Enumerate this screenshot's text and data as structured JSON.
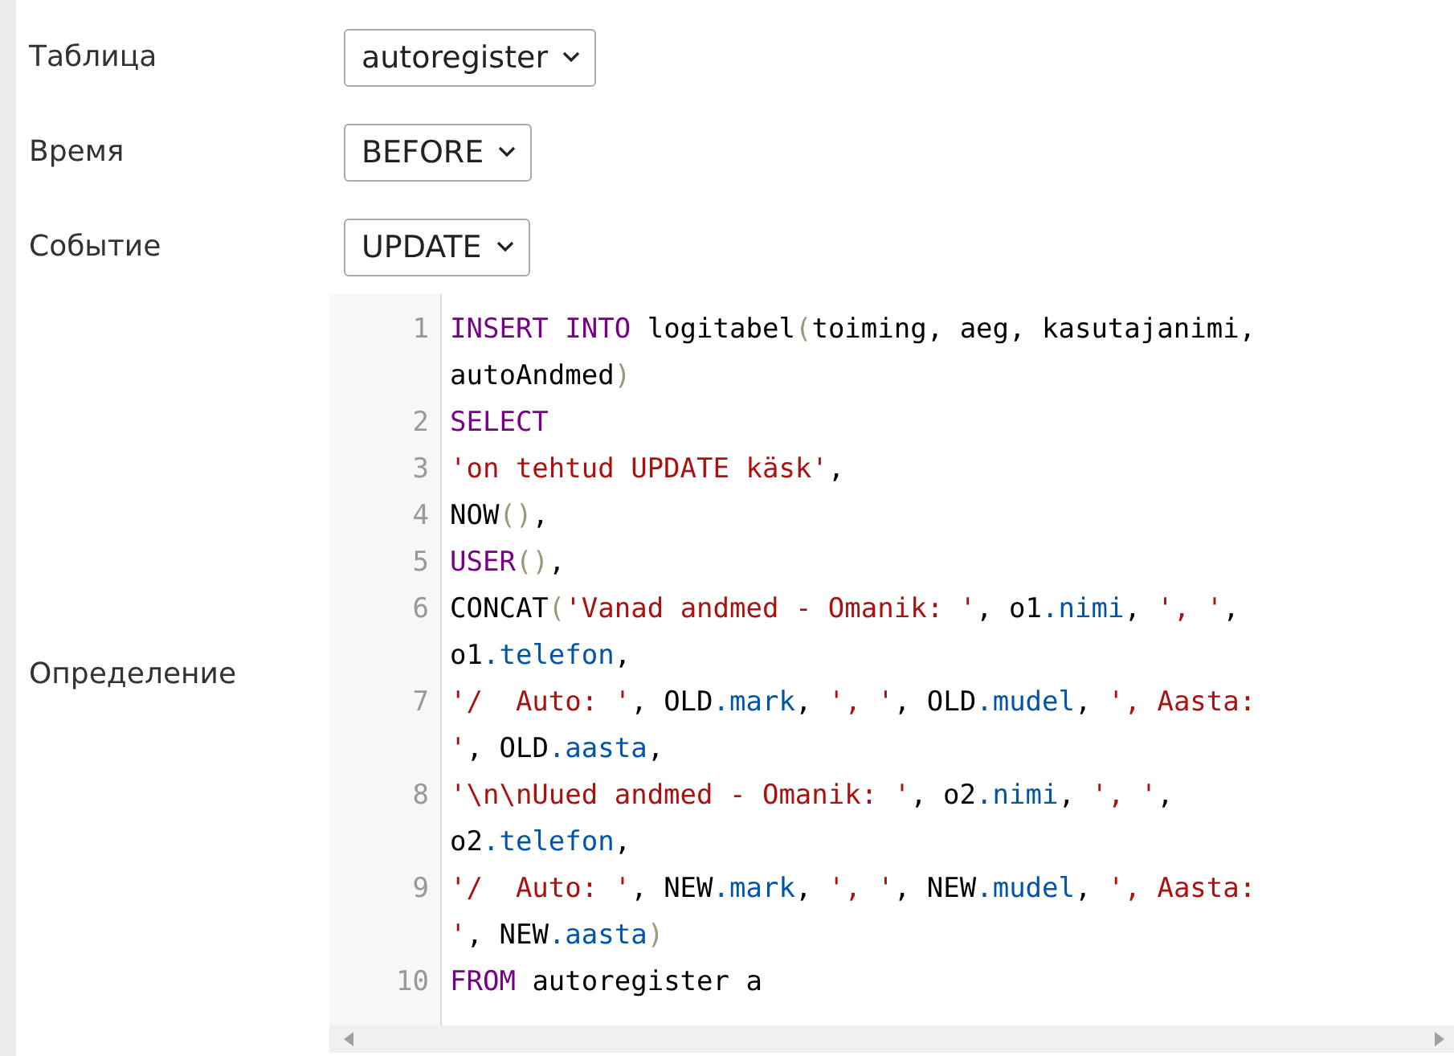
{
  "fields": [
    {
      "label": "Таблица",
      "value": "autoregister"
    },
    {
      "label": "Время",
      "value": "BEFORE"
    },
    {
      "label": "Событие",
      "value": "UPDATE"
    }
  ],
  "definition": {
    "label": "Определение",
    "lines": [
      {
        "number": "1",
        "tokens": [
          {
            "kind": "keyword",
            "text": "INSERT INTO"
          },
          {
            "kind": "plain",
            "text": " logitabel"
          },
          {
            "kind": "paren",
            "text": "("
          },
          {
            "kind": "plain",
            "text": "toiming, aeg, kasutajanimi, autoAndmed"
          },
          {
            "kind": "paren",
            "text": ")"
          }
        ]
      },
      {
        "number": "2",
        "tokens": [
          {
            "kind": "keyword",
            "text": "SELECT"
          }
        ]
      },
      {
        "number": "3",
        "tokens": [
          {
            "kind": "string",
            "text": "'on tehtud UPDATE käsk'"
          },
          {
            "kind": "plain",
            "text": ","
          }
        ]
      },
      {
        "number": "4",
        "tokens": [
          {
            "kind": "plain",
            "text": "NOW"
          },
          {
            "kind": "paren",
            "text": "()"
          },
          {
            "kind": "plain",
            "text": ","
          }
        ]
      },
      {
        "number": "5",
        "tokens": [
          {
            "kind": "keyword",
            "text": "USER"
          },
          {
            "kind": "paren",
            "text": "()"
          },
          {
            "kind": "plain",
            "text": ","
          }
        ]
      },
      {
        "number": "6",
        "tokens": [
          {
            "kind": "plain",
            "text": "CONCAT"
          },
          {
            "kind": "paren",
            "text": "("
          },
          {
            "kind": "string",
            "text": "'Vanad andmed - Omanik: '"
          },
          {
            "kind": "plain",
            "text": ", o1"
          },
          {
            "kind": "property",
            "text": ".nimi"
          },
          {
            "kind": "plain",
            "text": ", "
          },
          {
            "kind": "string",
            "text": "', '"
          },
          {
            "kind": "plain",
            "text": ", o1"
          },
          {
            "kind": "property",
            "text": ".telefon"
          },
          {
            "kind": "plain",
            "text": ","
          }
        ]
      },
      {
        "number": "7",
        "tokens": [
          {
            "kind": "string",
            "text": "'/  Auto: '"
          },
          {
            "kind": "plain",
            "text": ", OLD"
          },
          {
            "kind": "property",
            "text": ".mark"
          },
          {
            "kind": "plain",
            "text": ", "
          },
          {
            "kind": "string",
            "text": "', '"
          },
          {
            "kind": "plain",
            "text": ", OLD"
          },
          {
            "kind": "property",
            "text": ".mudel"
          },
          {
            "kind": "plain",
            "text": ", "
          },
          {
            "kind": "string",
            "text": "', Aasta: '"
          },
          {
            "kind": "plain",
            "text": ", OLD"
          },
          {
            "kind": "property",
            "text": ".aasta"
          },
          {
            "kind": "plain",
            "text": ","
          }
        ]
      },
      {
        "number": "8",
        "tokens": [
          {
            "kind": "string",
            "text": "'\\n\\nUued andmed - Omanik: '"
          },
          {
            "kind": "plain",
            "text": ", o2"
          },
          {
            "kind": "property",
            "text": ".nimi"
          },
          {
            "kind": "plain",
            "text": ", "
          },
          {
            "kind": "string",
            "text": "', '"
          },
          {
            "kind": "plain",
            "text": ", o2"
          },
          {
            "kind": "property",
            "text": ".telefon"
          },
          {
            "kind": "plain",
            "text": ","
          }
        ]
      },
      {
        "number": "9",
        "tokens": [
          {
            "kind": "string",
            "text": "'/  Auto: '"
          },
          {
            "kind": "plain",
            "text": ", NEW"
          },
          {
            "kind": "property",
            "text": ".mark"
          },
          {
            "kind": "plain",
            "text": ", "
          },
          {
            "kind": "string",
            "text": "', '"
          },
          {
            "kind": "plain",
            "text": ", NEW"
          },
          {
            "kind": "property",
            "text": ".mudel"
          },
          {
            "kind": "plain",
            "text": ", "
          },
          {
            "kind": "string",
            "text": "', Aasta: '"
          },
          {
            "kind": "plain",
            "text": ", NEW"
          },
          {
            "kind": "property",
            "text": ".aasta"
          },
          {
            "kind": "paren",
            "text": ")"
          }
        ]
      },
      {
        "number": "10",
        "tokens": [
          {
            "kind": "keyword",
            "text": "FROM"
          },
          {
            "kind": "plain",
            "text": " autoregister a"
          }
        ]
      }
    ]
  }
}
